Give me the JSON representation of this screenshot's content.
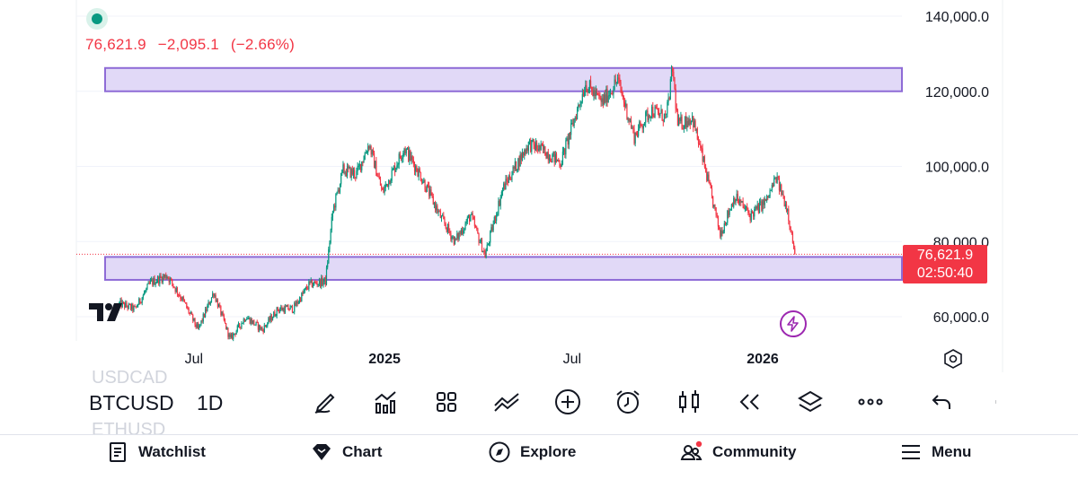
{
  "quote": {
    "last": "76,621.9",
    "change": "−2,095.1",
    "change_pct": "(−2.66%)"
  },
  "price_axis": {
    "labels": [
      "140,000.0",
      "120,000.0",
      "100,000.0",
      "80,000.0",
      "60,000.0"
    ]
  },
  "price_tag": {
    "price": "76,621.9",
    "countdown": "02:50:40"
  },
  "time_axis": {
    "labels": [
      {
        "text": "Jul",
        "major": false
      },
      {
        "text": "2025",
        "major": true
      },
      {
        "text": "Jul",
        "major": false
      },
      {
        "text": "2026",
        "major": true
      }
    ]
  },
  "toolbar": {
    "symbol": "BTCUSD",
    "interval": "1D",
    "ghost_above": "USDCAD",
    "ghost_below": "ETHUSD",
    "tools": [
      "drawing-tools-icon",
      "indicators-icon",
      "templates-icon",
      "compare-icon",
      "add-icon",
      "alert-icon",
      "chart-type-icon",
      "replay-icon",
      "layers-icon",
      "more-icon",
      "undo-icon"
    ]
  },
  "nav": {
    "items": [
      {
        "label": "Watchlist",
        "icon": "watchlist-icon"
      },
      {
        "label": "Chart",
        "icon": "chart-diamond-icon"
      },
      {
        "label": "Explore",
        "icon": "compass-icon"
      },
      {
        "label": "Community",
        "icon": "community-icon"
      },
      {
        "label": "Menu",
        "icon": "hamburger-icon"
      }
    ]
  },
  "colors": {
    "up": "#089981",
    "down": "#f23645",
    "zone_fill": "#e1d9f7",
    "zone_stroke": "#8e6bd6",
    "accent": "#9c27b0"
  },
  "chart_data": {
    "type": "candlestick",
    "symbol": "BTCUSD",
    "interval": "1D",
    "ylim": [
      55000,
      142000
    ],
    "y_ticks": [
      140000,
      120000,
      100000,
      80000,
      60000
    ],
    "last_price": 76621.9,
    "zones": [
      {
        "low": 120000,
        "high": 126200
      },
      {
        "low": 69800,
        "high": 75900
      }
    ],
    "series_close": [
      [
        "2024-04-20",
        63500
      ],
      [
        "2024-05-05",
        62000
      ],
      [
        "2024-05-20",
        69000
      ],
      [
        "2024-06-05",
        71000
      ],
      [
        "2024-06-20",
        64500
      ],
      [
        "2024-07-05",
        56500
      ],
      [
        "2024-07-20",
        66500
      ],
      [
        "2024-08-05",
        54000
      ],
      [
        "2024-08-20",
        60000
      ],
      [
        "2024-09-05",
        56500
      ],
      [
        "2024-09-20",
        62000
      ],
      [
        "2024-10-05",
        62200
      ],
      [
        "2024-10-20",
        68500
      ],
      [
        "2024-11-05",
        69500
      ],
      [
        "2024-11-12",
        88000
      ],
      [
        "2024-11-22",
        99000
      ],
      [
        "2024-12-05",
        98000
      ],
      [
        "2024-12-17",
        106000
      ],
      [
        "2024-12-30",
        93000
      ],
      [
        "2025-01-20",
        105000
      ],
      [
        "2025-02-05",
        97500
      ],
      [
        "2025-02-25",
        86000
      ],
      [
        "2025-03-10",
        80000
      ],
      [
        "2025-03-25",
        87000
      ],
      [
        "2025-04-08",
        76300
      ],
      [
        "2025-04-25",
        94000
      ],
      [
        "2025-05-20",
        106000
      ],
      [
        "2025-06-05",
        104000
      ],
      [
        "2025-06-20",
        101000
      ],
      [
        "2025-07-14",
        122000
      ],
      [
        "2025-07-30",
        117000
      ],
      [
        "2025-08-14",
        123000
      ],
      [
        "2025-08-30",
        108000
      ],
      [
        "2025-09-15",
        115000
      ],
      [
        "2025-09-30",
        113000
      ],
      [
        "2025-10-06",
        126000
      ],
      [
        "2025-10-11",
        111000
      ],
      [
        "2025-10-25",
        113000
      ],
      [
        "2025-11-05",
        101000
      ],
      [
        "2025-11-21",
        82000
      ],
      [
        "2025-12-05",
        92000
      ],
      [
        "2025-12-20",
        87000
      ],
      [
        "2026-01-05",
        91000
      ],
      [
        "2026-01-14",
        97000
      ],
      [
        "2026-01-25",
        88500
      ],
      [
        "2026-02-01",
        76621.9
      ]
    ],
    "time_axis_labels": [
      "Jul",
      "2025",
      "Jul",
      "2026"
    ],
    "price_axis_labels": [
      "140,000.0",
      "120,000.0",
      "100,000.0",
      "80,000.0",
      "60,000.0"
    ]
  }
}
